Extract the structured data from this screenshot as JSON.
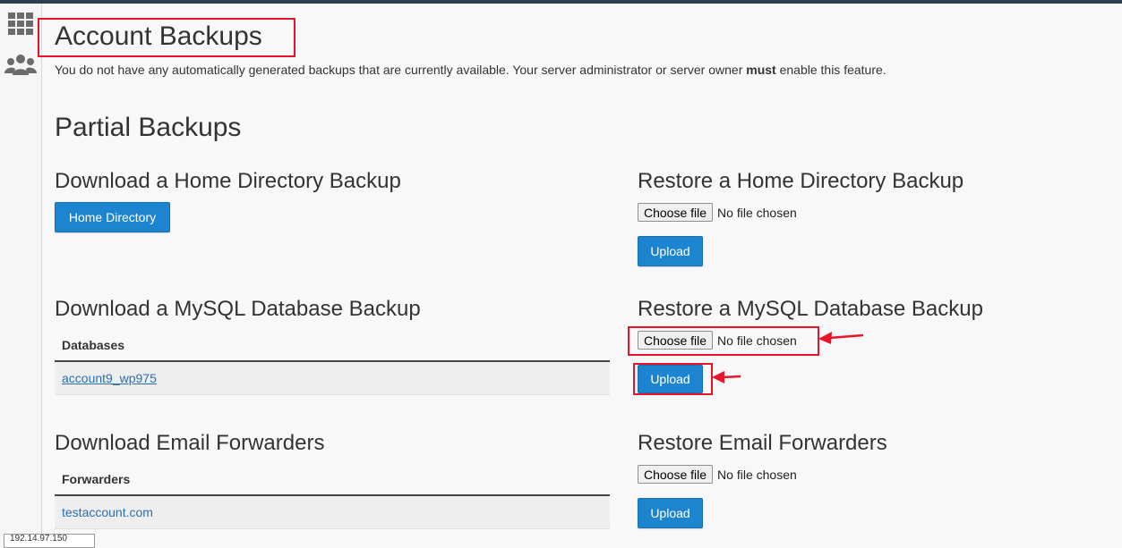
{
  "page": {
    "title": "Account Backups",
    "notice_before": "You do not have any automatically generated backups that are currently available. Your server administrator or server owner ",
    "notice_bold": "must",
    "notice_after": " enable this feature."
  },
  "partial": {
    "heading": "Partial Backups",
    "home_download": {
      "heading": "Download a Home Directory Backup",
      "button": "Home Directory"
    },
    "home_restore": {
      "heading": "Restore a Home Directory Backup",
      "choose": "Choose file",
      "nofile": "No file chosen",
      "upload": "Upload"
    },
    "mysql_download": {
      "heading": "Download a MySQL Database Backup",
      "column": "Databases",
      "rows": [
        "account9_wp975"
      ]
    },
    "mysql_restore": {
      "heading": "Restore a MySQL Database Backup",
      "choose": "Choose file",
      "nofile": "No file chosen",
      "upload": "Upload"
    },
    "email_download": {
      "heading": "Download Email Forwarders",
      "column": "Forwarders",
      "rows": [
        "testaccount.com"
      ]
    },
    "email_restore": {
      "heading": "Restore Email Forwarders",
      "choose": "Choose file",
      "nofile": "No file chosen",
      "upload": "Upload"
    }
  },
  "status": {
    "ip": "192.14.97.150"
  },
  "colors": {
    "accent": "#1d84cf",
    "highlight": "#e8142b",
    "topbar": "#2c3e50"
  },
  "icons": {
    "sidebar_top": "grid-icon",
    "sidebar_second": "users-icon"
  }
}
